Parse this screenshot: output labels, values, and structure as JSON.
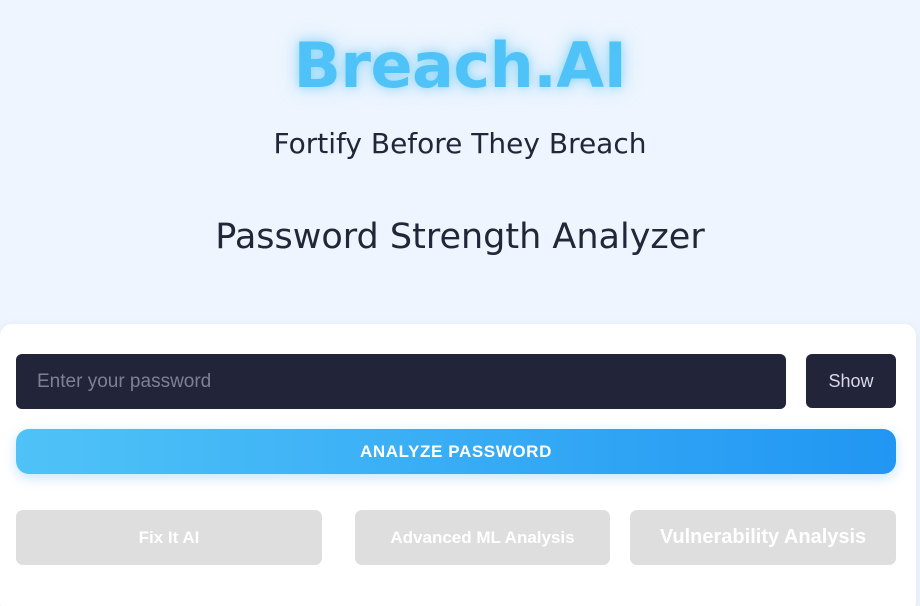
{
  "header": {
    "brand": "Breach.AI",
    "tagline": "Fortify Before They Breach",
    "section_title": "Password Strength Analyzer"
  },
  "form": {
    "password_placeholder": "Enter your password",
    "password_value": "",
    "show_label": "Show",
    "analyze_label": "ANALYZE PASSWORD"
  },
  "tools": {
    "fix_it_label": "Fix It AI",
    "ml_label": "Advanced ML Analysis",
    "vulnerability_label": "Vulnerability Analysis"
  },
  "colors": {
    "brand": "#4fc3f7",
    "accent_start": "#4fc3f7",
    "accent_end": "#2196f3",
    "dark_field": "#222439",
    "disabled_button": "#dedede",
    "page_background": "#eef5fe"
  }
}
